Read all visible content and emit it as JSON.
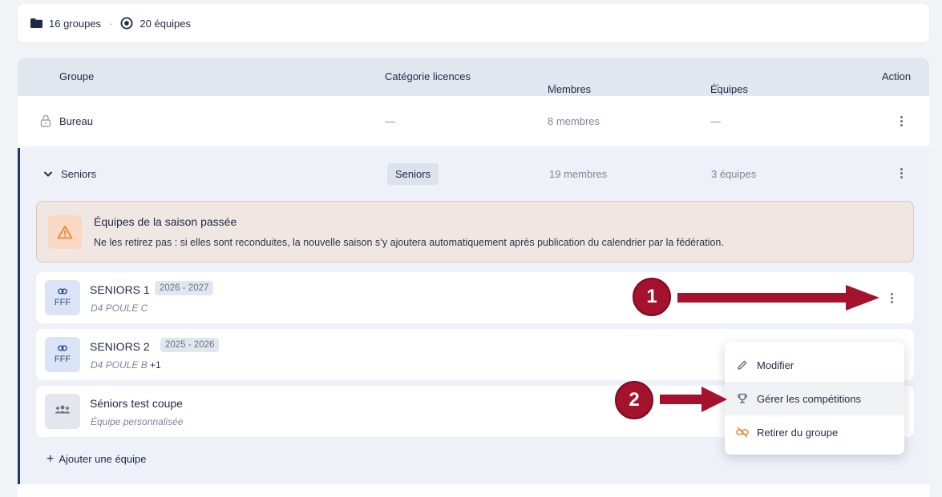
{
  "summary": {
    "groups": "16 groupes",
    "teams": "20 équipes"
  },
  "table": {
    "headers": {
      "group": "Groupe",
      "category": "Catégorie licences",
      "members": "Membres",
      "teams": "Équipes",
      "action": "Action"
    },
    "bureau": {
      "name": "Bureau",
      "category": "—",
      "members": "8 membres",
      "teams": "—"
    },
    "seniors": {
      "name": "Seniors",
      "category": "Seniors",
      "members": "19 membres",
      "teams": "3 équipes"
    }
  },
  "alert": {
    "title": "Équipes de la saison passée",
    "message": "Ne les retirez pas : si elles sont reconduites, la nouvelle saison s’y ajoutera automatiquement après publication du calendrier par la fédération."
  },
  "teams": [
    {
      "name": "SENIORS 1",
      "season": "2026 - 2027",
      "sub": "D4 POULE C",
      "extra": "",
      "logo": "FFF"
    },
    {
      "name": "SENIORS 2",
      "season": "2025 - 2026",
      "sub": "D4 POULE B",
      "extra": "+1",
      "logo": "FFF"
    },
    {
      "name": "Séniors test coupe",
      "season": "",
      "sub": "Équipe personnalisée",
      "extra": "",
      "logo": ""
    }
  ],
  "add_team": "Ajouter une équipe",
  "menu": {
    "edit": "Modifier",
    "competitions": "Gérer les compétitions",
    "remove": "Retirer du groupe"
  },
  "callouts": {
    "one": "1",
    "two": "2"
  },
  "colors": {
    "accent": "#1f3a6e",
    "callout": "#a4122d",
    "warning": "#e8892b"
  }
}
